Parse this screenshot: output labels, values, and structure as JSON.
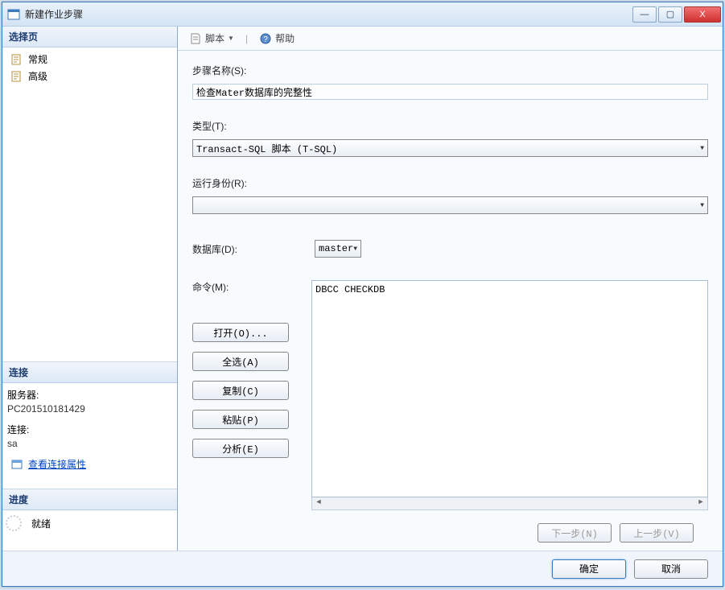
{
  "window": {
    "title": "新建作业步骤"
  },
  "winbtns": {
    "min": "—",
    "max": "▢",
    "close": "X"
  },
  "sidebar": {
    "select_page": "选择页",
    "nav": [
      {
        "label": "常规"
      },
      {
        "label": "高级"
      }
    ],
    "connection": {
      "header": "连接",
      "server_label": "服务器:",
      "server_value": "PC201510181429",
      "conn_label": "连接:",
      "conn_value": "sa",
      "view_props": "查看连接属性"
    },
    "progress": {
      "header": "进度",
      "status": "就绪"
    }
  },
  "toolbar": {
    "script": "脚本",
    "help": "帮助"
  },
  "form": {
    "step_name_label": "步骤名称(S):",
    "step_name_value": "检查Mater数据库的完整性",
    "type_label": "类型(T):",
    "type_value": "Transact-SQL 脚本 (T-SQL)",
    "run_as_label": "运行身份(R):",
    "run_as_value": "",
    "database_label": "数据库(D):",
    "database_value": "master",
    "command_label": "命令(M):",
    "command_value": "DBCC CHECKDB",
    "buttons": {
      "open": "打开(O)...",
      "select_all": "全选(A)",
      "copy": "复制(C)",
      "paste": "粘贴(P)",
      "parse": "分析(E)"
    },
    "nav": {
      "next": "下一步(N)",
      "prev": "上一步(V)"
    }
  },
  "footer": {
    "ok": "确定",
    "cancel": "取消"
  }
}
